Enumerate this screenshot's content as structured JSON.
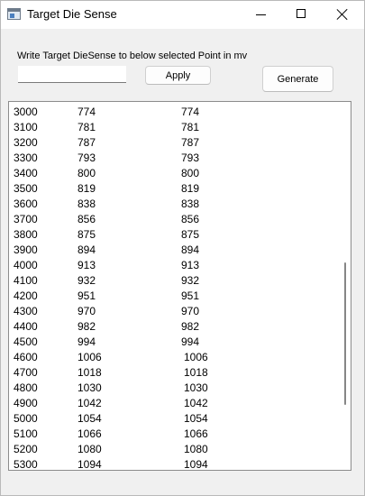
{
  "window": {
    "title": "Target Die Sense"
  },
  "form": {
    "instruction": "Write Target DieSense to below selected Point in mv",
    "input_value": "",
    "apply_label": "Apply",
    "generate_label": "Generate"
  },
  "table": {
    "rows": [
      [
        "3000",
        "774",
        "774"
      ],
      [
        "3100",
        "781",
        "781"
      ],
      [
        "3200",
        "787",
        "787"
      ],
      [
        "3300",
        "793",
        "793"
      ],
      [
        "3400",
        "800",
        "800"
      ],
      [
        "3500",
        "819",
        "819"
      ],
      [
        "3600",
        "838",
        "838"
      ],
      [
        "3700",
        "856",
        "856"
      ],
      [
        "3800",
        "875",
        "875"
      ],
      [
        "3900",
        "894",
        "894"
      ],
      [
        "4000",
        "913",
        "913"
      ],
      [
        "4100",
        "932",
        "932"
      ],
      [
        "4200",
        "951",
        "951"
      ],
      [
        "4300",
        "970",
        "970"
      ],
      [
        "4400",
        "982",
        "982"
      ],
      [
        "4500",
        "994",
        "994"
      ],
      [
        "4600",
        "1006",
        "1006"
      ],
      [
        "4700",
        "1018",
        "1018"
      ],
      [
        "4800",
        "1030",
        "1030"
      ],
      [
        "4900",
        "1042",
        "1042"
      ],
      [
        "5000",
        "1054",
        "1054"
      ],
      [
        "5100",
        "1066",
        "1066"
      ],
      [
        "5200",
        "1080",
        "1080"
      ],
      [
        "5300",
        "1094",
        "1094"
      ]
    ]
  },
  "icons": {
    "app": "window-app-icon",
    "minimize": "minimize-icon",
    "maximize": "maximize-icon",
    "close": "close-icon"
  }
}
